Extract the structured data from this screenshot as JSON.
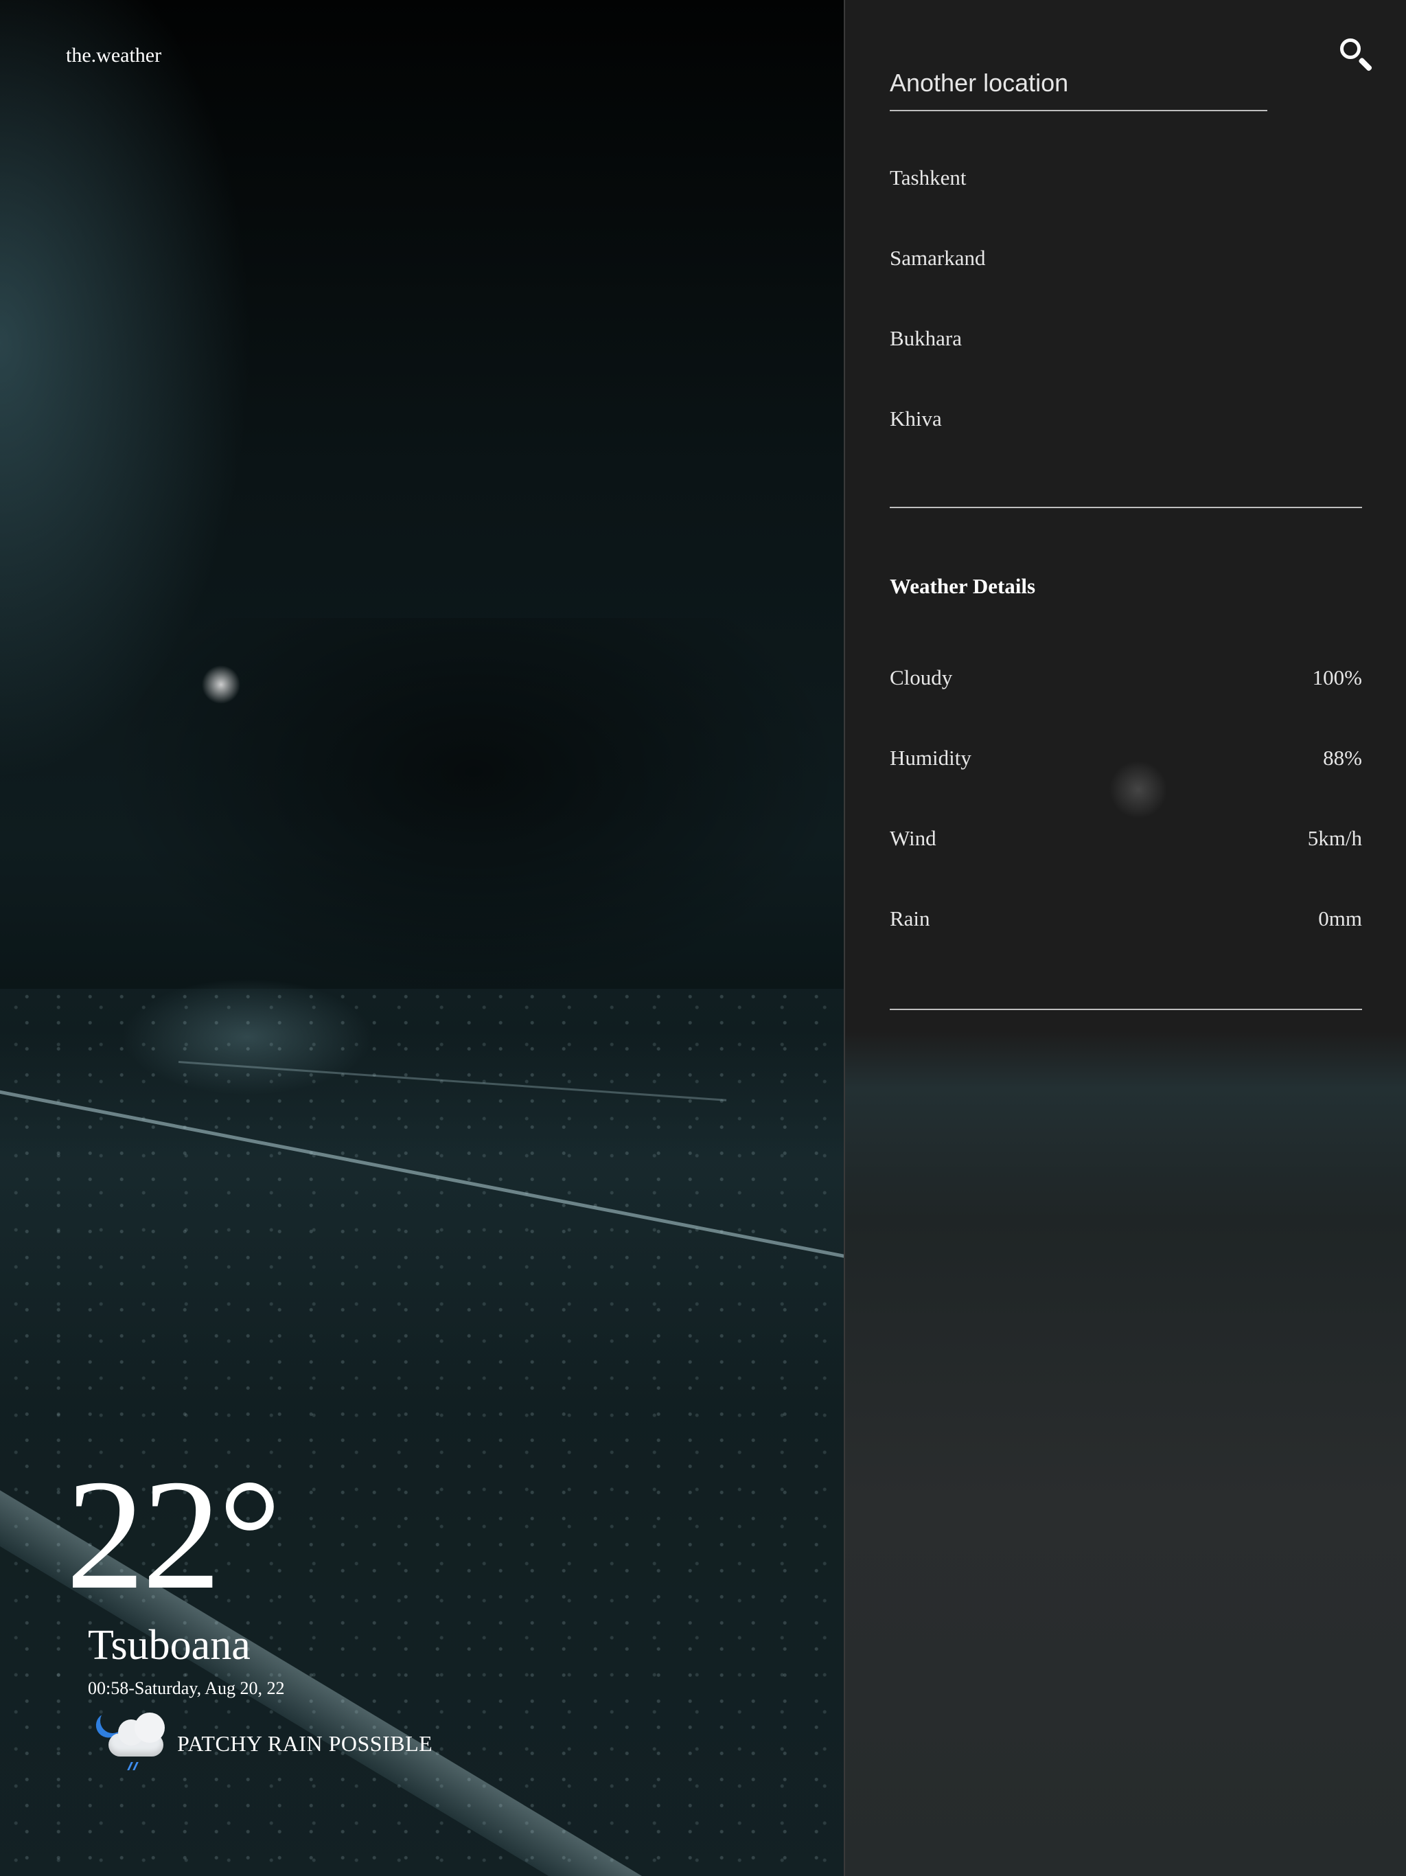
{
  "brand": "the.weather",
  "current": {
    "temperature": "22°",
    "location": "Tsuboana",
    "datetime": "00:58-Saturday, Aug 20, 22",
    "condition": "PATCHY RAIN POSSIBLE",
    "condition_icon": "moon-cloud-rain-icon"
  },
  "search": {
    "placeholder": "Another location",
    "icon": "search-icon"
  },
  "locations": [
    "Tashkent",
    "Samarkand",
    "Bukhara",
    "Khiva"
  ],
  "details": {
    "title": "Weather Details",
    "rows": [
      {
        "label": "Cloudy",
        "value": "100%"
      },
      {
        "label": "Humidity",
        "value": "88%"
      },
      {
        "label": "Wind",
        "value": "5km/h"
      },
      {
        "label": "Rain",
        "value": "0mm"
      }
    ]
  },
  "colors": {
    "panel_background": "#1d1d1d",
    "divider": "#bfbfbf",
    "text": "#ffffff",
    "moon_accent": "#2f7fe0"
  }
}
